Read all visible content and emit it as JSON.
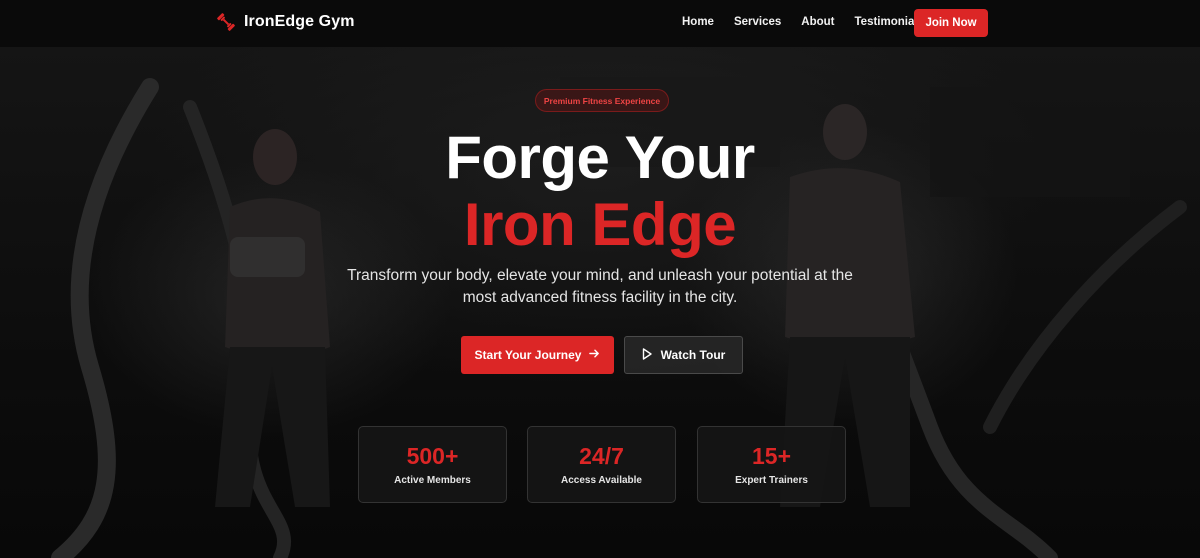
{
  "brand": {
    "name": "IronEdge Gym",
    "icon": "dumbbell-icon",
    "accent_color": "#dc2626"
  },
  "nav": {
    "links": [
      {
        "label": "Home"
      },
      {
        "label": "Services"
      },
      {
        "label": "About"
      },
      {
        "label": "Testimonials"
      }
    ],
    "cta_label": "Join Now"
  },
  "hero": {
    "badge": "Premium Fitness Experience",
    "headline_line1": "Forge Your",
    "headline_line2": "Iron Edge",
    "subtitle": "Transform your body, elevate your mind, and unleash your potential at the most advanced fitness facility in the city.",
    "primary_button": {
      "label": "Start Your Journey",
      "icon": "arrow-right-icon"
    },
    "secondary_button": {
      "label": "Watch Tour",
      "icon": "play-icon"
    },
    "background_image": "battle-ropes-training-photo"
  },
  "stats": [
    {
      "value": "500+",
      "label": "Active Members"
    },
    {
      "value": "24/7",
      "label": "Access Available"
    },
    {
      "value": "15+",
      "label": "Expert Trainers"
    }
  ]
}
